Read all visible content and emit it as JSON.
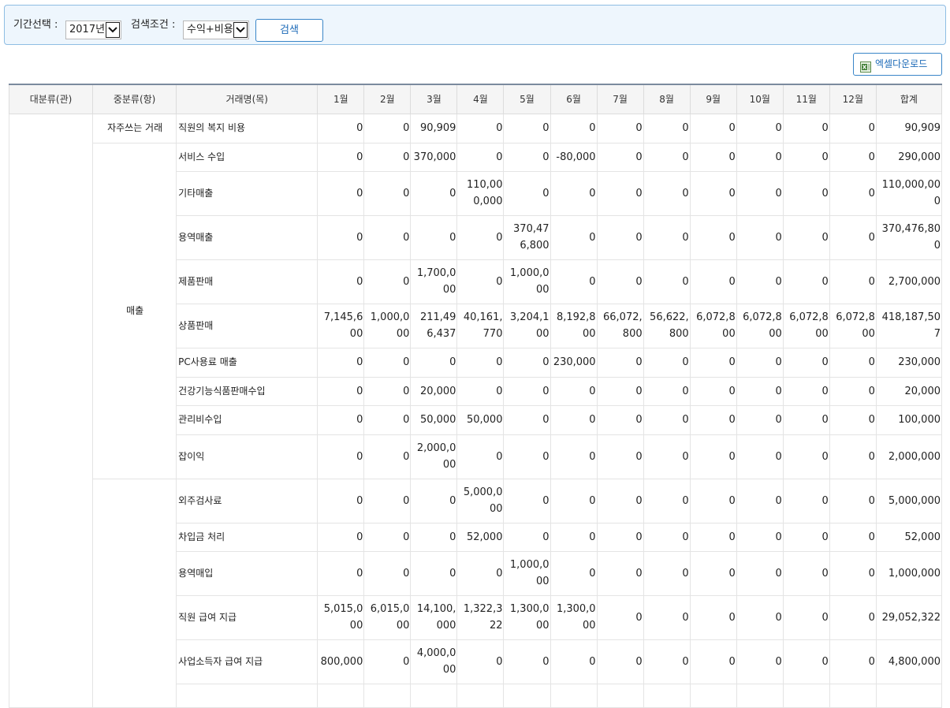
{
  "search": {
    "period_label": "기간선택 :",
    "period_value": "2017년",
    "condition_label": "검색조건 :",
    "condition_value": "수익+비용",
    "search_button": "검색"
  },
  "excel_button": "엑셀다운로드",
  "table": {
    "headers": [
      "대분류(관)",
      "중분류(항)",
      "거래명(목)",
      "1월",
      "2월",
      "3월",
      "4월",
      "5월",
      "6월",
      "7월",
      "8월",
      "9월",
      "10월",
      "11월",
      "12월",
      "합계"
    ],
    "groups": [
      {
        "name": "자주쓰는 거래",
        "rows": [
          {
            "name": "직원의 복지 비용",
            "values": [
              "0",
              "0",
              "90,909",
              "0",
              "0",
              "0",
              "0",
              "0",
              "0",
              "0",
              "0",
              "0",
              "90,909"
            ]
          }
        ]
      },
      {
        "name": "매출",
        "rows": [
          {
            "name": "서비스 수입",
            "values": [
              "0",
              "0",
              "370,000",
              "0",
              "0",
              "-80,000",
              "0",
              "0",
              "0",
              "0",
              "0",
              "0",
              "290,000"
            ]
          },
          {
            "name": "기타매출",
            "values": [
              "0",
              "0",
              "0",
              "110,000,000",
              "0",
              "0",
              "0",
              "0",
              "0",
              "0",
              "0",
              "0",
              "110,000,000"
            ]
          },
          {
            "name": "용역매출",
            "values": [
              "0",
              "0",
              "0",
              "0",
              "370,476,800",
              "0",
              "0",
              "0",
              "0",
              "0",
              "0",
              "0",
              "370,476,800"
            ]
          },
          {
            "name": "제품판매",
            "values": [
              "0",
              "0",
              "1,700,000",
              "0",
              "1,000,000",
              "0",
              "0",
              "0",
              "0",
              "0",
              "0",
              "0",
              "2,700,000"
            ]
          },
          {
            "name": "상품판매",
            "values": [
              "7,145,600",
              "1,000,000",
              "211,496,437",
              "40,161,770",
              "3,204,100",
              "8,192,800",
              "66,072,800",
              "56,622,800",
              "6,072,800",
              "6,072,800",
              "6,072,800",
              "6,072,800",
              "418,187,507"
            ]
          },
          {
            "name": "PC사용료 매출",
            "values": [
              "0",
              "0",
              "0",
              "0",
              "0",
              "230,000",
              "0",
              "0",
              "0",
              "0",
              "0",
              "0",
              "230,000"
            ]
          },
          {
            "name": "건강기능식품판매수입",
            "values": [
              "0",
              "0",
              "20,000",
              "0",
              "0",
              "0",
              "0",
              "0",
              "0",
              "0",
              "0",
              "0",
              "20,000"
            ]
          },
          {
            "name": "관리비수입",
            "values": [
              "0",
              "0",
              "50,000",
              "50,000",
              "0",
              "0",
              "0",
              "0",
              "0",
              "0",
              "0",
              "0",
              "100,000"
            ]
          },
          {
            "name": "잡이익",
            "values": [
              "0",
              "0",
              "2,000,000",
              "0",
              "0",
              "0",
              "0",
              "0",
              "0",
              "0",
              "0",
              "0",
              "2,000,000"
            ]
          }
        ]
      },
      {
        "name": "",
        "rows": [
          {
            "name": "외주검사료",
            "values": [
              "0",
              "0",
              "0",
              "5,000,000",
              "0",
              "0",
              "0",
              "0",
              "0",
              "0",
              "0",
              "0",
              "5,000,000"
            ]
          },
          {
            "name": "차입금 처리",
            "values": [
              "0",
              "0",
              "0",
              "52,000",
              "0",
              "0",
              "0",
              "0",
              "0",
              "0",
              "0",
              "0",
              "52,000"
            ]
          },
          {
            "name": "용역매입",
            "values": [
              "0",
              "0",
              "0",
              "0",
              "1,000,000",
              "0",
              "0",
              "0",
              "0",
              "0",
              "0",
              "0",
              "1,000,000"
            ]
          },
          {
            "name": "직원 급여 지급",
            "values": [
              "5,015,000",
              "6,015,000",
              "14,100,000",
              "1,322,322",
              "1,300,000",
              "1,300,000",
              "0",
              "0",
              "0",
              "0",
              "0",
              "0",
              "29,052,322"
            ]
          },
          {
            "name": "사업소득자 급여 지급",
            "values": [
              "800,000",
              "0",
              "4,000,000",
              "0",
              "0",
              "0",
              "0",
              "0",
              "0",
              "0",
              "0",
              "0",
              "4,800,000"
            ]
          },
          {
            "name": "",
            "values": [
              "",
              "",
              "",
              "",
              "",
              "",
              "",
              "",
              "",
              "",
              "",
              "",
              ""
            ]
          }
        ]
      }
    ]
  }
}
